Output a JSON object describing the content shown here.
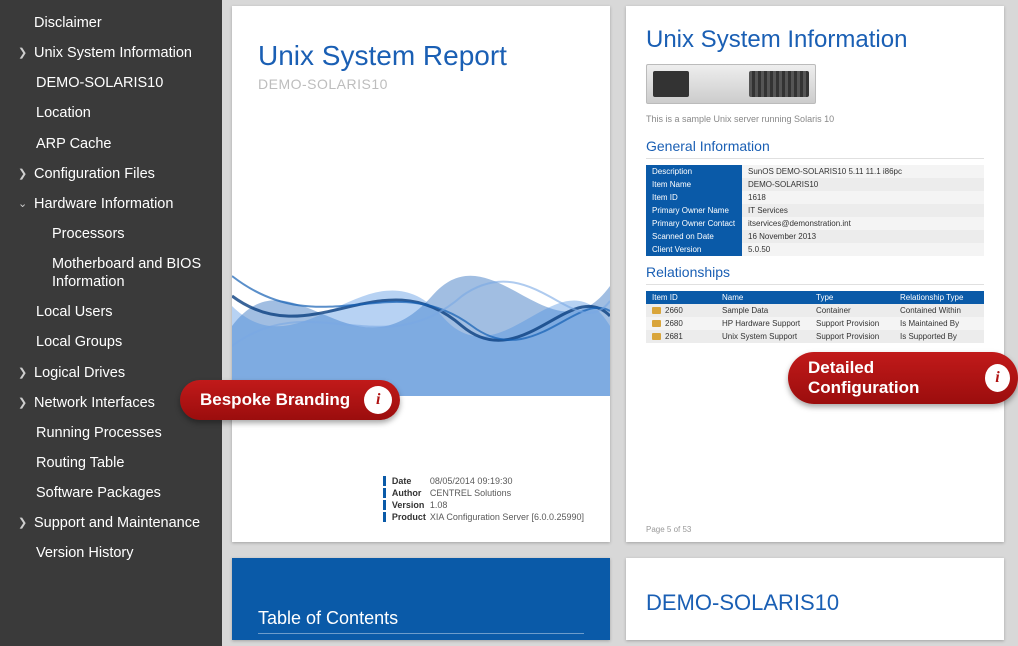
{
  "sidebar": {
    "items": [
      {
        "label": "Disclaimer",
        "expand": "",
        "level": 0
      },
      {
        "label": "Unix System Information",
        "expand": ">",
        "level": 0
      },
      {
        "label": "DEMO-SOLARIS10",
        "expand": "",
        "level": 1
      },
      {
        "label": "Location",
        "expand": "",
        "level": 1
      },
      {
        "label": "ARP Cache",
        "expand": "",
        "level": 1
      },
      {
        "label": "Configuration Files",
        "expand": ">",
        "level": 0
      },
      {
        "label": "Hardware Information",
        "expand": "v",
        "level": 0
      },
      {
        "label": "Processors",
        "expand": "",
        "level": 2
      },
      {
        "label": "Motherboard and BIOS Information",
        "expand": "",
        "level": 2
      },
      {
        "label": "Local Users",
        "expand": "",
        "level": 1
      },
      {
        "label": "Local Groups",
        "expand": "",
        "level": 1
      },
      {
        "label": "Logical Drives",
        "expand": ">",
        "level": 0
      },
      {
        "label": "Network Interfaces",
        "expand": ">",
        "level": 0
      },
      {
        "label": "Running Processes",
        "expand": "",
        "level": 1
      },
      {
        "label": "Routing Table",
        "expand": "",
        "level": 1
      },
      {
        "label": "Software Packages",
        "expand": "",
        "level": 1
      },
      {
        "label": "Support and Maintenance",
        "expand": ">",
        "level": 0
      },
      {
        "label": "Version History",
        "expand": "",
        "level": 1
      }
    ]
  },
  "cover": {
    "title": "Unix System Report",
    "subtitle": "DEMO-SOLARIS10",
    "meta": {
      "date_k": "Date",
      "date_v": "08/05/2014 09:19:30",
      "author_k": "Author",
      "author_v": "CENTREL Solutions",
      "version_k": "Version",
      "version_v": "1.08",
      "product_k": "Product",
      "product_v": "XIA Configuration Server [6.0.0.25990]"
    }
  },
  "page2": {
    "title": "Unix System Information",
    "desc": "This is a sample Unix server running Solaris 10",
    "sec1": "General Information",
    "info": {
      "r1k": "Description",
      "r1v": "SunOS DEMO-SOLARIS10 5.11 11.1 i86pc",
      "r2k": "Item Name",
      "r2v": "DEMO-SOLARIS10",
      "r3k": "Item ID",
      "r3v": "1618",
      "r4k": "Primary Owner Name",
      "r4v": "IT Services",
      "r5k": "Primary Owner Contact",
      "r5v": "itservices@demonstration.int",
      "r6k": "Scanned on Date",
      "r6v": "16 November 2013",
      "r7k": "Client Version",
      "r7v": "5.0.50"
    },
    "sec2": "Relationships",
    "rel": {
      "h1": "Item ID",
      "h2": "Name",
      "h3": "Type",
      "h4": "Relationship Type",
      "rows": [
        {
          "id": "2660",
          "name": "Sample Data",
          "type": "Container",
          "rel": "Contained Within"
        },
        {
          "id": "2680",
          "name": "HP Hardware Support",
          "type": "Support Provision",
          "rel": "Is Maintained By"
        },
        {
          "id": "2681",
          "name": "Unix System Support",
          "type": "Support Provision",
          "rel": "Is Supported By"
        }
      ]
    },
    "pagenum": "Page 5 of 53"
  },
  "toc": {
    "title": "Table of Contents"
  },
  "page4": {
    "title": "DEMO-SOLARIS10"
  },
  "callouts": {
    "branding": "Bespoke Branding",
    "detailed": "Detailed Configuration"
  },
  "colors": {
    "accent": "#0a5aa8",
    "heading": "#1a5fb4",
    "pill": "#b01212"
  }
}
